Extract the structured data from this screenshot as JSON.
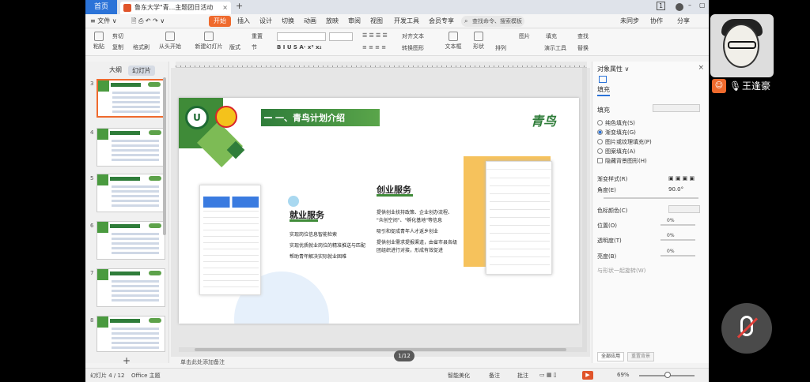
{
  "titlebar": {
    "home_tab": "首页",
    "doc_tab": "鲁东大学\"青...主题团日活动",
    "page_count": "1",
    "close": "×",
    "plus": "+"
  },
  "menubar": {
    "file": "≡ 文件 ∨",
    "start": "开始",
    "items": [
      "插入",
      "设计",
      "切换",
      "动画",
      "放映",
      "审阅",
      "视图",
      "开发工具",
      "会员专享"
    ],
    "search_placeholder": "查找命令、搜索模板",
    "sync": "未同步",
    "collab": "协作",
    "share": "分享"
  },
  "ribbon": {
    "paste": "粘贴",
    "cut": "剪切",
    "copy": "复制",
    "format_painter": "格式刷",
    "from_start": "从头开始",
    "new_slide": "新建幻灯片",
    "layout": "版式",
    "section": "节",
    "reset": "重置",
    "textbox": "文本框",
    "shape": "形状",
    "arrange": "排列",
    "picture": "图片",
    "fill": "填充",
    "find": "查找",
    "present": "演示工具",
    "select": "替换",
    "convert": "转换图形",
    "text_box2": "对齐文本"
  },
  "leftpanel": {
    "tab_outline": "大纲",
    "tab_slides": "幻灯片",
    "thumbs": [
      {
        "num": "3",
        "selected": true
      },
      {
        "num": "4",
        "selected": false
      },
      {
        "num": "5",
        "selected": false
      },
      {
        "num": "6",
        "selected": false
      },
      {
        "num": "7",
        "selected": false
      },
      {
        "num": "8",
        "selected": false
      }
    ],
    "add": "+"
  },
  "slide": {
    "title": "一、青鸟计划介绍",
    "brand": "青鸟",
    "h_jiuye": "就业服务",
    "jiuye_lines": [
      "实现岗位信息智能检索",
      "实现优质就业岗位的精准推送与匹配",
      "帮助青年解决实际就业困难"
    ],
    "h_chuangye": "创业服务",
    "chuangye_lines": [
      "提供创业扶持政策、企业创办流程、",
      "\"众创空间\"、\"孵化基地\"等信息",
      "吸引和促成青年人才返乡创业",
      "提供创业需求提报渠道，由省市县各级",
      "团组织进行对接，形成有效促进"
    ]
  },
  "editor": {
    "page_pill": "1/12",
    "notes": "单击此处添加备注"
  },
  "rightpanel": {
    "title": "对象属性 ∨",
    "tab": "填充",
    "section": "填充",
    "radios": [
      {
        "label": "纯色填充(S)",
        "on": false
      },
      {
        "label": "渐变填充(G)",
        "on": true
      },
      {
        "label": "图片或纹理填充(P)",
        "on": false
      },
      {
        "label": "图案填充(A)",
        "on": false
      }
    ],
    "hide_bg": "隐藏背景图形(H)",
    "gradient_style": "渐变样式(R)",
    "angle": "角度(E)",
    "angle_val": "90.0°",
    "stop_color": "色标颜色(C)",
    "position": "位置(O)",
    "position_val": "0%",
    "transparency": "透明度(T)",
    "transparency_val": "0%",
    "brightness": "亮度(B)",
    "brightness_val": "0%",
    "apply_all_label": "与形状一起旋转(W)",
    "apply_all": "全部应用",
    "reset_bg": "重置背景"
  },
  "statusbar": {
    "slide_num": "幻灯片 4 / 12",
    "theme": "Office 主题",
    "beautify": "智能美化",
    "notes": "备注",
    "comments": "批注",
    "zoom": "69%"
  },
  "overlay": {
    "speaker_name": "王逢豪"
  }
}
